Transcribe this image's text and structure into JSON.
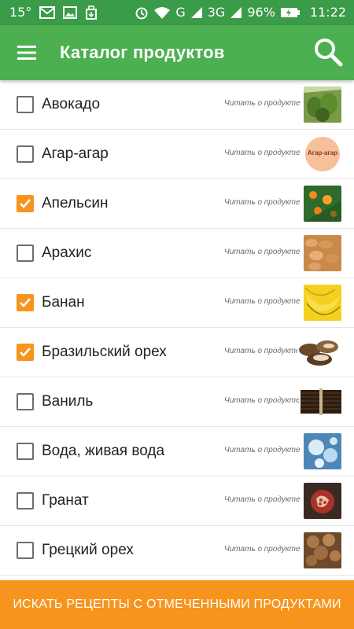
{
  "status_bar": {
    "temperature": "15°",
    "network": "G",
    "network2": "3G",
    "battery": "96%",
    "time": "11:22",
    "icons": [
      "mail-icon",
      "image-icon",
      "usb-icon",
      "alarm-icon",
      "wifi-icon",
      "signal-icon",
      "battery-charging-icon"
    ]
  },
  "app_bar": {
    "title": "Каталог продуктов",
    "menu_icon": "hamburger-menu-icon",
    "search_icon": "search-icon"
  },
  "read_label": "Читать о продукте",
  "products": [
    {
      "name": "Авокадо",
      "checked": false,
      "thumb": "avocado"
    },
    {
      "name": "Агар-агар",
      "checked": false,
      "thumb": "agar",
      "thumb_text": "Агар-агар"
    },
    {
      "name": "Апельсин",
      "checked": true,
      "thumb": "orange"
    },
    {
      "name": "Арахис",
      "checked": false,
      "thumb": "peanut"
    },
    {
      "name": "Банан",
      "checked": true,
      "thumb": "banana"
    },
    {
      "name": "Бразильский орех",
      "checked": true,
      "thumb": "brazilnut"
    },
    {
      "name": "Ваниль",
      "checked": false,
      "thumb": "vanilla"
    },
    {
      "name": "Вода, живая вода",
      "checked": false,
      "thumb": "water"
    },
    {
      "name": "Гранат",
      "checked": false,
      "thumb": "pomegranate"
    },
    {
      "name": "Грецкий орех",
      "checked": false,
      "thumb": "walnut"
    }
  ],
  "bottom_button": {
    "label": "ИСКАТЬ РЕЦЕПТЫ С ОТМЕЧЕННЫМИ ПРОДУКТАМИ"
  },
  "colors": {
    "app_bar": "#4caf50",
    "status_bar": "#3a9b48",
    "accent": "#f7941d"
  }
}
